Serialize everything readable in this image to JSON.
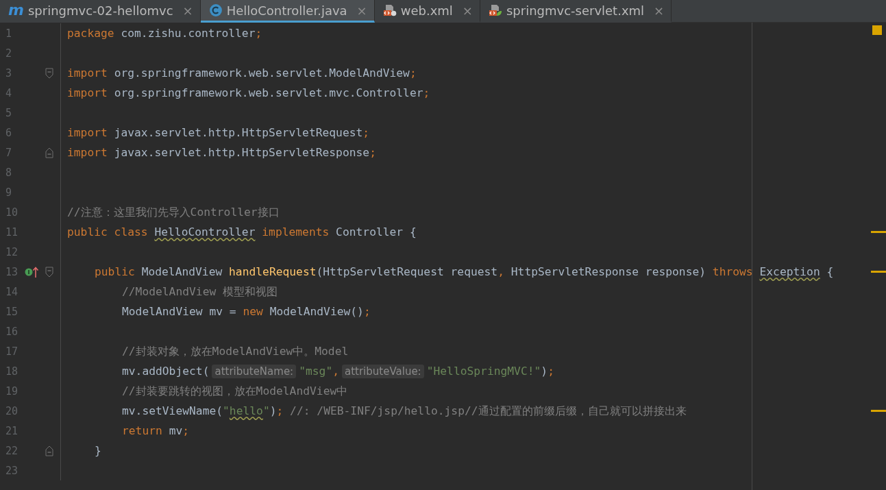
{
  "tabs": [
    {
      "kind": "module",
      "glyph": "m",
      "label": "springmvc-02-hellomvc",
      "selected": false,
      "close": "×"
    },
    {
      "kind": "class",
      "label": "HelloController.java",
      "selected": true,
      "close": "×"
    },
    {
      "kind": "xml",
      "label": "web.xml",
      "selected": false,
      "close": "×"
    },
    {
      "kind": "spring-xml",
      "label": "springmvc-servlet.xml",
      "selected": false,
      "close": "×"
    }
  ],
  "editor": {
    "lines": [
      {
        "number": "1",
        "tokens": [
          {
            "kind": "kw",
            "text": "package"
          },
          {
            "kind": "text",
            "text": " com.zishu.controller"
          },
          {
            "kind": "punct",
            "text": ";"
          }
        ]
      },
      {
        "number": "2"
      },
      {
        "number": "3",
        "fold_start": true,
        "tokens": [
          {
            "kind": "kw",
            "text": "import"
          },
          {
            "kind": "text",
            "text": " org.springframework.web.servlet.ModelAndView"
          },
          {
            "kind": "punct",
            "text": ";"
          }
        ]
      },
      {
        "number": "4",
        "tokens": [
          {
            "kind": "kw",
            "text": "import"
          },
          {
            "kind": "text",
            "text": " org.springframework.web.servlet.mvc.Controller"
          },
          {
            "kind": "punct",
            "text": ";"
          }
        ]
      },
      {
        "number": "5"
      },
      {
        "number": "6",
        "tokens": [
          {
            "kind": "kw",
            "text": "import"
          },
          {
            "kind": "text",
            "text": " javax.servlet.http.HttpServletRequest"
          },
          {
            "kind": "punct",
            "text": ";"
          }
        ]
      },
      {
        "number": "7",
        "fold_end": true,
        "tokens": [
          {
            "kind": "kw",
            "text": "import"
          },
          {
            "kind": "text",
            "text": " javax.servlet.http.HttpServletResponse"
          },
          {
            "kind": "punct",
            "text": ";"
          }
        ]
      },
      {
        "number": "8"
      },
      {
        "number": "9"
      },
      {
        "number": "10",
        "tokens": [
          {
            "kind": "comment",
            "text": "//注意：这里我们先导入Controller接口"
          }
        ]
      },
      {
        "number": "11",
        "stripe": true,
        "tokens": [
          {
            "kind": "kw",
            "text": "public class "
          },
          {
            "kind": "text",
            "text": "HelloController",
            "warning": true
          },
          {
            "kind": "kw",
            "text": " implements"
          },
          {
            "kind": "text",
            "text": " Controller {"
          }
        ],
        "children": [
          {
            "number": "12"
          },
          {
            "number": "13",
            "fold_start": true,
            "implements_marker": true,
            "stripe": true,
            "tokens": [
              {
                "kind": "kw",
                "text": "public"
              },
              {
                "kind": "text",
                "text": " ModelAndView "
              },
              {
                "kind": "method",
                "text": "handleRequest"
              },
              {
                "kind": "text",
                "text": "(HttpServletRequest request"
              },
              {
                "kind": "punct",
                "text": ","
              },
              {
                "kind": "text",
                "text": " HttpServletResponse response) "
              },
              {
                "kind": "kw",
                "text": "throws "
              },
              {
                "kind": "text",
                "text": "Exception",
                "warning": true
              },
              {
                "kind": "text",
                "text": " {"
              }
            ],
            "children": [
              {
                "number": "14",
                "tokens": [
                  {
                    "kind": "comment",
                    "text": "//ModelAndView 模型和视图"
                  }
                ]
              },
              {
                "number": "15",
                "tokens": [
                  {
                    "kind": "text",
                    "text": "ModelAndView mv = "
                  },
                  {
                    "kind": "kw",
                    "text": "new"
                  },
                  {
                    "kind": "text",
                    "text": " ModelAndView()"
                  },
                  {
                    "kind": "punct",
                    "text": ";"
                  }
                ]
              },
              {
                "number": "16"
              },
              {
                "number": "17",
                "tokens": [
                  {
                    "kind": "comment",
                    "text": "//封装对象，放在ModelAndView中。Model"
                  }
                ]
              },
              {
                "number": "18",
                "tokens": [
                  {
                    "kind": "text",
                    "text": "mv.addObject("
                  },
                  {
                    "kind": "hint",
                    "text": "attributeName:"
                  },
                  {
                    "kind": "str",
                    "text": "\"msg\""
                  },
                  {
                    "kind": "punct",
                    "text": ","
                  },
                  {
                    "kind": "hint",
                    "text": "attributeValue:"
                  },
                  {
                    "kind": "str",
                    "text": "\"HelloSpringMVC!\""
                  },
                  {
                    "kind": "text",
                    "text": ")"
                  },
                  {
                    "kind": "punct",
                    "text": ";"
                  }
                ]
              },
              {
                "number": "19",
                "tokens": [
                  {
                    "kind": "comment",
                    "text": "//封装要跳转的视图，放在ModelAndView中"
                  }
                ]
              },
              {
                "number": "20",
                "stripe": true,
                "tokens": [
                  {
                    "kind": "text",
                    "text": "mv.setViewName("
                  },
                  {
                    "kind": "str",
                    "text": "\""
                  },
                  {
                    "kind": "str",
                    "text": "hello",
                    "warning": true
                  },
                  {
                    "kind": "str",
                    "text": "\""
                  },
                  {
                    "kind": "text",
                    "text": ")"
                  },
                  {
                    "kind": "punct",
                    "text": ";"
                  },
                  {
                    "kind": "comment",
                    "text": " //: /WEB-INF/jsp/hello.jsp//通过配置的前缀后缀，自己就可以拼接出来"
                  }
                ]
              },
              {
                "number": "21",
                "tokens": [
                  {
                    "kind": "kw",
                    "text": "return"
                  },
                  {
                    "kind": "text",
                    "text": " mv"
                  },
                  {
                    "kind": "punct",
                    "text": ";"
                  }
                ]
              }
            ]
          },
          {
            "number": "22",
            "fold_end": true,
            "tokens": [
              {
                "kind": "text",
                "text": "}"
              }
            ]
          },
          {
            "number": "23"
          }
        ]
      }
    ]
  }
}
